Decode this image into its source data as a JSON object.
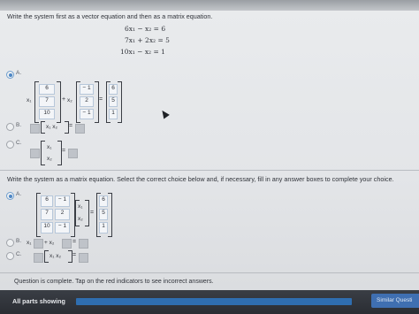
{
  "q1": {
    "prompt": "Write the system first as a vector equation and then as a matrix equation.",
    "equations": [
      "6x₁  −   x₂ = 6",
      "7x₁  +  2x₂ = 5",
      "10x₁  −   x₂ = 1"
    ],
    "optA": {
      "letter": "A.",
      "x1": "x₁",
      "x2": "x₂",
      "plus": "+",
      "eq": "=",
      "col1": [
        "6",
        "7",
        "10"
      ],
      "col2": [
        "− 1",
        "2",
        "− 1"
      ],
      "rhs": [
        "6",
        "5",
        "1"
      ]
    },
    "optB": {
      "letter": "B.",
      "vec": "x₁   x₂",
      "eq": "="
    },
    "optC": {
      "letter": "C.",
      "vec1": "x₁",
      "vec2": "x₂",
      "eq": "="
    }
  },
  "q2": {
    "prompt": "Write the system as a matrix equation. Select the correct choice below and, if necessary, fill in any answer boxes to complete your choice.",
    "optA": {
      "letter": "A.",
      "matrix": [
        [
          "6",
          "− 1"
        ],
        [
          "7",
          "2"
        ],
        [
          "10",
          "− 1"
        ]
      ],
      "xvec": [
        "x₁",
        "x₂"
      ],
      "eq": "=",
      "rhs": [
        "6",
        "5",
        "1"
      ]
    },
    "optB": {
      "letter": "B.",
      "x1": "x₁",
      "plus": "+ x₂",
      "eq": "="
    },
    "optC": {
      "letter": "C.",
      "vec": "x₁   x₂",
      "eq": "="
    }
  },
  "status": "Question is complete. Tap on the red indicators to see incorrect answers.",
  "footer": {
    "label": "All parts showing",
    "similar": "Similar Questi"
  }
}
